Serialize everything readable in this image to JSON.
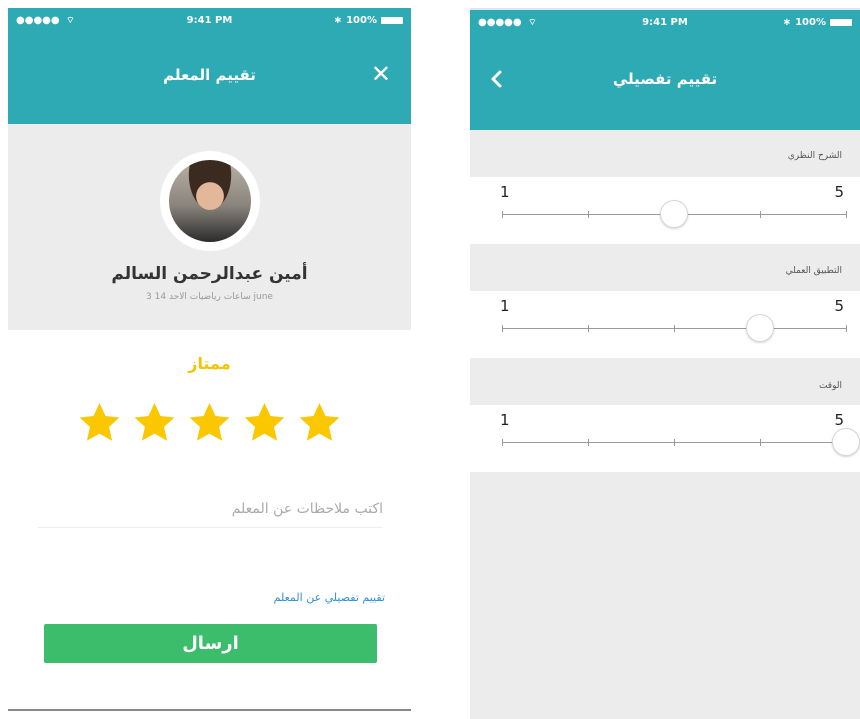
{
  "status_bar": {
    "signal": "●●●●● ",
    "time": "9:41 PM",
    "battery": "100%"
  },
  "rating_screen": {
    "title": "تقييم المعلم",
    "close_icon": "close-icon",
    "teacher": {
      "name": "أمين عبدالرحمن السالم",
      "meta": "3 ساعات رياضيات الاحد 14 june"
    },
    "rating_label": "ممتاز",
    "stars": {
      "value": 5,
      "max": 5,
      "color": "#fac700"
    },
    "notes_placeholder": "اكتب ملاحظات عن المعلم",
    "detail_link": "تقييم تفصيلي عن المعلم",
    "send_label": "ارسال",
    "colors": {
      "header": "#2eaab4",
      "send_button": "#3cbd6b",
      "link": "#2f8fd8",
      "rating_label": "#f7c300"
    }
  },
  "detail_screen": {
    "title": "تقييم تفصيلي",
    "back_icon": "chevron-left-icon",
    "sections": [
      {
        "label": "الشرح النظري",
        "min": "1",
        "max": "5",
        "value": 3
      },
      {
        "label": "التطبيق العملي",
        "min": "1",
        "max": "5",
        "value": 4
      },
      {
        "label": "الوقت",
        "min": "1",
        "max": "5",
        "value": 5
      }
    ]
  }
}
